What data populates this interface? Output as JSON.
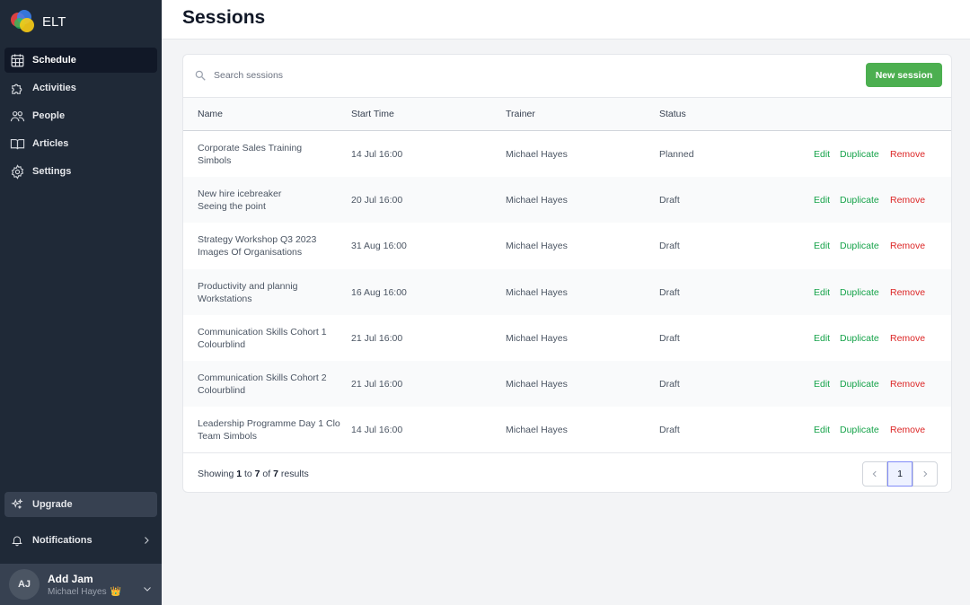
{
  "app": {
    "name": "ELT"
  },
  "sidebar": {
    "items": [
      {
        "label": "Schedule",
        "icon": "calendar-icon",
        "active": true
      },
      {
        "label": "Activities",
        "icon": "puzzle-icon",
        "active": false
      },
      {
        "label": "People",
        "icon": "people-icon",
        "active": false
      },
      {
        "label": "Articles",
        "icon": "book-icon",
        "active": false
      },
      {
        "label": "Settings",
        "icon": "gear-icon",
        "active": false
      }
    ],
    "upgrade_label": "Upgrade",
    "notifications_label": "Notifications",
    "account": {
      "initials": "AJ",
      "name": "Add Jam",
      "subtitle": "Michael Hayes",
      "badge": "👑"
    }
  },
  "page": {
    "title": "Sessions"
  },
  "search": {
    "placeholder": "Search sessions",
    "value": ""
  },
  "toolbar": {
    "new_label": "New session"
  },
  "table": {
    "columns": [
      "Name",
      "Start Time",
      "Trainer",
      "Status"
    ],
    "actions": {
      "edit": "Edit",
      "duplicate": "Duplicate",
      "remove": "Remove"
    },
    "rows": [
      {
        "name": "Corporate Sales Training",
        "sub": "Simbols",
        "start": "14 Jul 16:00",
        "trainer": "Michael Hayes",
        "status": "Planned"
      },
      {
        "name": "New hire icebreaker",
        "sub": "Seeing the point",
        "start": "20 Jul 16:00",
        "trainer": "Michael Hayes",
        "status": "Draft"
      },
      {
        "name": "Strategy Workshop Q3 2023",
        "sub": "Images Of Organisations",
        "start": "31 Aug 16:00",
        "trainer": "Michael Hayes",
        "status": "Draft"
      },
      {
        "name": "Productivity and plannig",
        "sub": "Workstations",
        "start": "16 Aug 16:00",
        "trainer": "Michael Hayes",
        "status": "Draft"
      },
      {
        "name": "Communication Skills Cohort 1",
        "sub": "Colourblind",
        "start": "21 Jul 16:00",
        "trainer": "Michael Hayes",
        "status": "Draft"
      },
      {
        "name": "Communication Skills Cohort 2",
        "sub": "Colourblind",
        "start": "21 Jul 16:00",
        "trainer": "Michael Hayes",
        "status": "Draft"
      },
      {
        "name": "Leadership Programme Day 1 Clo",
        "sub": "Team Simbols",
        "start": "14 Jul 16:00",
        "trainer": "Michael Hayes",
        "status": "Draft"
      }
    ]
  },
  "pagination": {
    "prefix": "Showing",
    "from": "1",
    "to_word": "to",
    "to": "7",
    "of_word": "of",
    "total": "7",
    "suffix": "results",
    "current_page": "1"
  },
  "colors": {
    "accent": "#4caf50",
    "danger": "#dc2626",
    "sidebar": "#1f2937"
  }
}
